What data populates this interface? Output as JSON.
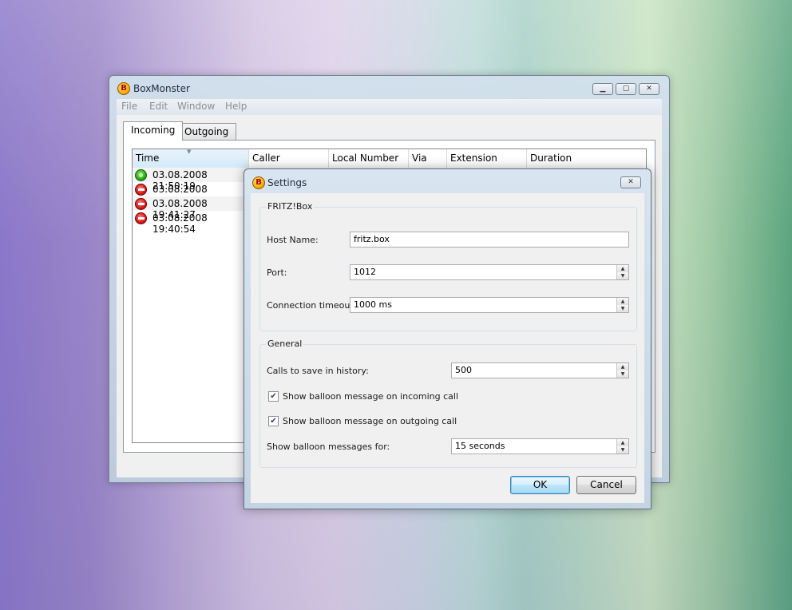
{
  "main_window": {
    "title": "BoxMonster",
    "menu": [
      "File",
      "Edit",
      "Window",
      "Help"
    ],
    "tabs": [
      "Incoming",
      "Outgoing"
    ],
    "columns": [
      "Time",
      "Caller",
      "Local Number",
      "Via",
      "Extension",
      "Duration"
    ],
    "calls": [
      {
        "status": "answered",
        "status_icon": "answered-call-icon",
        "time": "03.08.2008 21:50:19"
      },
      {
        "status": "missed",
        "status_icon": "missed-call-icon",
        "time": "03.08.2008 19:45:44"
      },
      {
        "status": "missed",
        "status_icon": "missed-call-icon",
        "time": "03.08.2008 19:41:27"
      },
      {
        "status": "missed",
        "status_icon": "missed-call-icon",
        "time": "03.08.2008 19:40:54"
      }
    ]
  },
  "settings": {
    "title": "Settings",
    "fritzbox_group": "FRITZ!Box",
    "host_name_label": "Host Name:",
    "host_name_value": "fritz.box",
    "port_label": "Port:",
    "port_value": "1012",
    "timeout_label": "Connection timeout:",
    "timeout_value": "1000 ms",
    "general_group": "General",
    "history_label": "Calls to save in history:",
    "history_value": "500",
    "balloon_incoming_label": "Show balloon message on incoming call",
    "balloon_incoming_checked": true,
    "balloon_outgoing_label": "Show balloon message on outgoing call",
    "balloon_outgoing_checked": true,
    "balloon_duration_label": "Show balloon messages for:",
    "balloon_duration_value": "15 seconds",
    "ok_label": "OK",
    "cancel_label": "Cancel"
  },
  "colors": {
    "accent": "#3c7fb1",
    "answered": "#2eae1a",
    "missed": "#dd1d1d"
  }
}
